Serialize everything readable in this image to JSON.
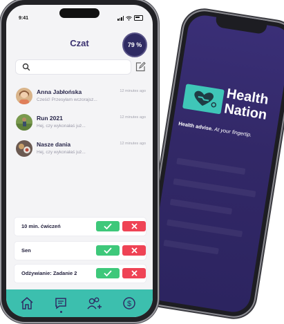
{
  "back_phone": {
    "brand": {
      "line1": "Health",
      "line2": "Nation"
    },
    "tagline": {
      "bold": "Health advise.",
      "italic": "At your fingertip."
    }
  },
  "front_phone": {
    "status_bar": {
      "time": "9:41"
    },
    "header": {
      "title": "Czat",
      "progress_label": "79 %"
    },
    "search": {
      "placeholder": ""
    },
    "chats": [
      {
        "name": "Anna Jabłońska",
        "preview": "Cześć! Przesyłam wczorajsz...",
        "time": "12 minutes ago",
        "avatar": "person-avatar"
      },
      {
        "name": "Run 2021",
        "preview": "Hej, czy wykonałaś już...",
        "time": "12 minutes ago",
        "avatar": "running-avatar"
      },
      {
        "name": "Nasze dania",
        "preview": "Hej, czy wykonałaś już...",
        "time": "12 minutes ago",
        "avatar": "food-avatar"
      }
    ],
    "tasks": [
      {
        "label": "10 min. ćwiczeń"
      },
      {
        "label": "Sen"
      },
      {
        "label": "Odżywianie: Zadanie 2"
      }
    ],
    "tabbar": {
      "items": [
        "home-icon",
        "chat-icon",
        "add-friend-icon",
        "payments-icon"
      ],
      "active": "chat-icon"
    }
  },
  "colors": {
    "title": "#3a3170",
    "badge": "#2f2b63",
    "accept": "#3ec87a",
    "reject": "#ef4355",
    "tabbar": "#3cbfae",
    "health_nation_bg": "#322867",
    "health_nation_logo": "#3fc6b8"
  }
}
